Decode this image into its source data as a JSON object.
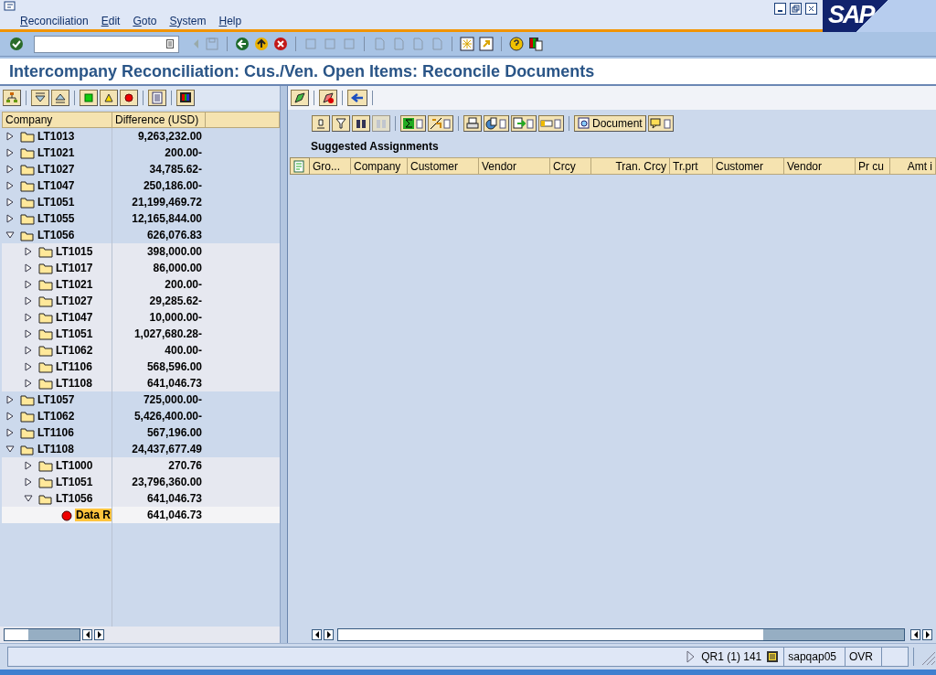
{
  "menu": [
    "Reconciliation",
    "Edit",
    "Goto",
    "System",
    "Help"
  ],
  "logo": "SAP",
  "title": "Intercompany Reconciliation: Cus./Ven. Open Items: Reconcile Documents",
  "tree": {
    "columns": [
      "Company",
      "Difference (USD)"
    ],
    "rows": [
      {
        "kind": "folder",
        "label": "LT1013",
        "value": "9,263,232.00",
        "expanded": false
      },
      {
        "kind": "folder",
        "label": "LT1021",
        "value": "200.00-",
        "expanded": false
      },
      {
        "kind": "folder",
        "label": "LT1027",
        "value": "34,785.62-",
        "expanded": false
      },
      {
        "kind": "folder",
        "label": "LT1047",
        "value": "250,186.00-",
        "expanded": false
      },
      {
        "kind": "folder",
        "label": "LT1051",
        "value": "21,199,469.72",
        "expanded": false
      },
      {
        "kind": "folder",
        "label": "LT1055",
        "value": "12,165,844.00",
        "expanded": false
      },
      {
        "kind": "folder",
        "label": "LT1056",
        "value": "626,076.83",
        "expanded": true,
        "children": [
          {
            "kind": "folder",
            "label": "LT1015",
            "value": "398,000.00",
            "expanded": false
          },
          {
            "kind": "folder",
            "label": "LT1017",
            "value": "86,000.00",
            "expanded": false
          },
          {
            "kind": "folder",
            "label": "LT1021",
            "value": "200.00-",
            "expanded": false
          },
          {
            "kind": "folder",
            "label": "LT1027",
            "value": "29,285.62-",
            "expanded": false
          },
          {
            "kind": "folder",
            "label": "LT1047",
            "value": "10,000.00-",
            "expanded": false
          },
          {
            "kind": "folder",
            "label": "LT1051",
            "value": "1,027,680.28-",
            "expanded": false
          },
          {
            "kind": "folder",
            "label": "LT1062",
            "value": "400.00-",
            "expanded": false
          },
          {
            "kind": "folder",
            "label": "LT1106",
            "value": "568,596.00",
            "expanded": false
          },
          {
            "kind": "folder",
            "label": "LT1108",
            "value": "641,046.73",
            "expanded": false
          }
        ]
      },
      {
        "kind": "folder",
        "label": "LT1057",
        "value": "725,000.00-",
        "expanded": false
      },
      {
        "kind": "folder",
        "label": "LT1062",
        "value": "5,426,400.00-",
        "expanded": false
      },
      {
        "kind": "folder",
        "label": "LT1106",
        "value": "567,196.00",
        "expanded": false
      },
      {
        "kind": "folder",
        "label": "LT1108",
        "value": "24,437,677.49",
        "expanded": true,
        "children": [
          {
            "kind": "folder",
            "label": "LT1000",
            "value": "270.76",
            "expanded": false
          },
          {
            "kind": "folder",
            "label": "LT1051",
            "value": "23,796,360.00",
            "expanded": false
          },
          {
            "kind": "folder",
            "label": "LT1056",
            "value": "641,046.73",
            "expanded": true,
            "children": [
              {
                "kind": "item",
                "label": "Data R",
                "value": "641,046.73",
                "selected": true
              }
            ]
          }
        ]
      }
    ]
  },
  "grid": {
    "document_button": "Document",
    "title": "Suggested Assignments",
    "columns": [
      {
        "label": "Gro...",
        "numeric": false
      },
      {
        "label": "Company",
        "numeric": false
      },
      {
        "label": "Customer",
        "numeric": false
      },
      {
        "label": "Vendor",
        "numeric": false
      },
      {
        "label": "Crcy",
        "numeric": false
      },
      {
        "label": "Tran. Crcy",
        "numeric": true
      },
      {
        "label": "Tr.prt",
        "numeric": false
      },
      {
        "label": "Customer",
        "numeric": false
      },
      {
        "label": "Vendor",
        "numeric": false
      },
      {
        "label": "Pr cu",
        "numeric": false
      },
      {
        "label": "Amt i",
        "numeric": true
      }
    ]
  },
  "status_bar": {
    "system": "QR1 (1) 141",
    "server": "sapqap05",
    "mode": "OVR"
  }
}
